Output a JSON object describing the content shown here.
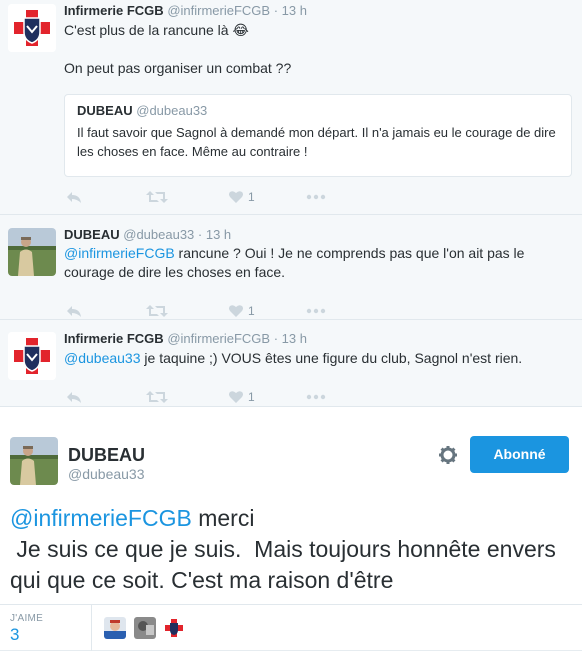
{
  "tweets": [
    {
      "fullname": "Infirmerie FCGB",
      "handle": "@infirmerieFCGB",
      "time": "· 13 h",
      "text_line1": "C'est plus de la rancune là 😂",
      "text_line2": "On peut pas organiser un combat ??",
      "like_count": "1",
      "quote": {
        "fullname": "DUBEAU",
        "handle": "@dubeau33",
        "text": "Il faut savoir que Sagnol à demandé mon départ. Il n'a jamais eu le courage de dire les choses en face. Même au contraire !"
      }
    },
    {
      "fullname": "DUBEAU",
      "handle": "@dubeau33",
      "time": "· 13 h",
      "mention": "@infirmerieFCGB",
      "text": " rancune ? Oui ! Je ne comprends pas que l'on ait pas le courage de dire les choses en face.",
      "like_count": "1"
    },
    {
      "fullname": "Infirmerie FCGB",
      "handle": "@infirmerieFCGB",
      "time": "· 13 h",
      "mention": "@dubeau33",
      "text": " je taquine ;) VOUS êtes une figure du club, Sagnol n'est rien.",
      "like_count": "1"
    }
  ],
  "main": {
    "fullname": "DUBEAU",
    "handle": "@dubeau33",
    "follow_label": "Abonné",
    "mention": "@infirmerieFCGB",
    "text_rest": " merci\n Je suis ce que je suis.  Mais toujours honnête envers qui que ce soit. C'est ma raison d'être",
    "likes_label": "J'AIME",
    "likes_value": "3"
  },
  "colors": {
    "link": "#1b95e0",
    "muted": "#8899a6",
    "button": "#1b95e0",
    "icon": "#ccd6dd"
  }
}
